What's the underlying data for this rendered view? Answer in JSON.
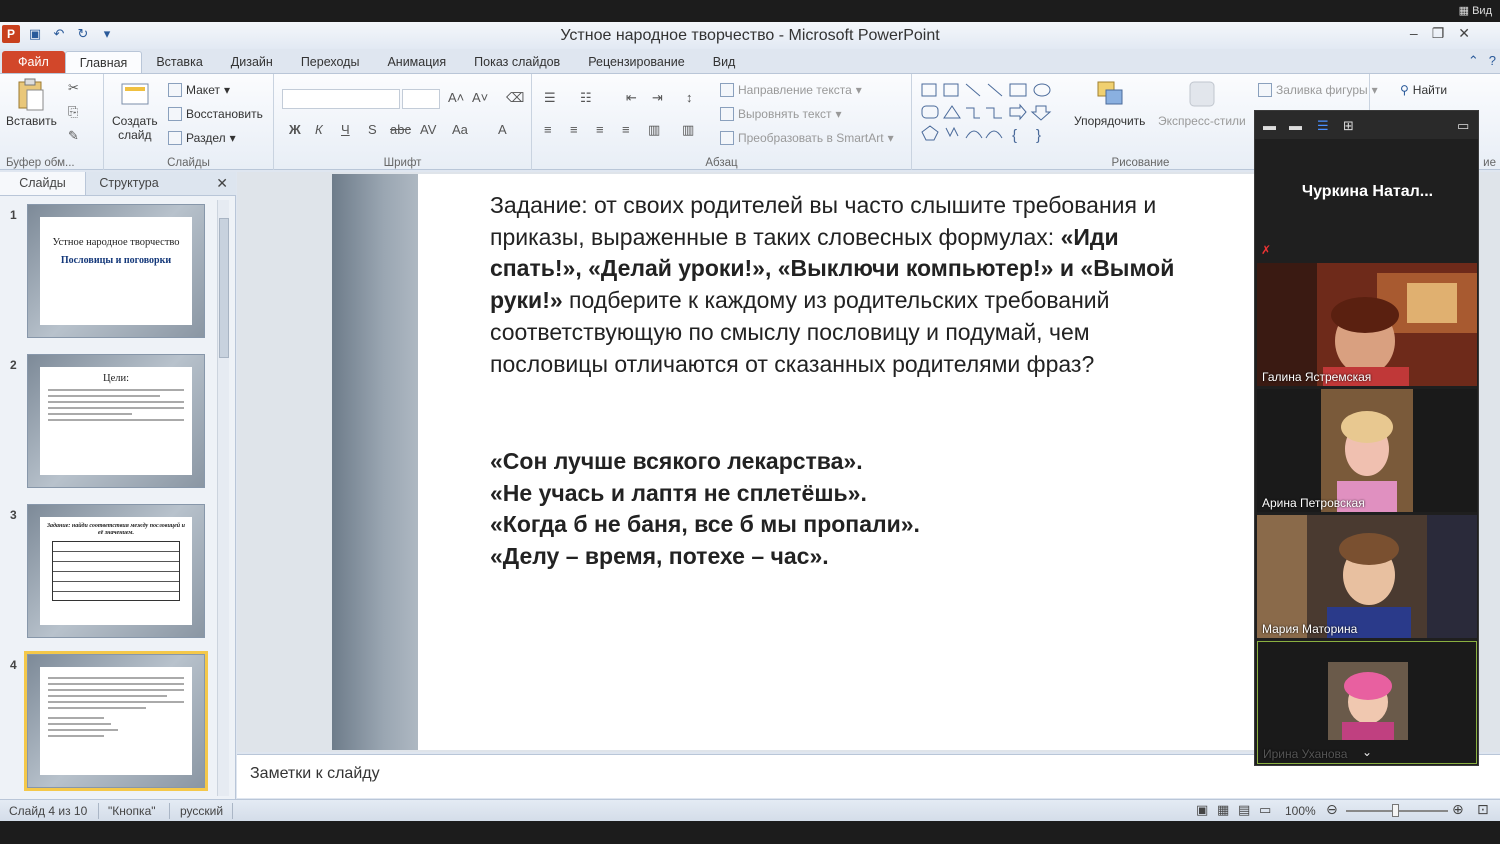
{
  "window": {
    "title": "Устное народное творчество  -  Microsoft PowerPoint"
  },
  "overlay": {
    "zoom_view_label": "Вид"
  },
  "ribbon": {
    "tabs": [
      "Файл",
      "Главная",
      "Вставка",
      "Дизайн",
      "Переходы",
      "Анимация",
      "Показ слайдов",
      "Рецензирование",
      "Вид"
    ],
    "active_tab": "Главная",
    "clipboard": {
      "paste": "Вставить",
      "label": "Буфер обм..."
    },
    "slides": {
      "create": "Создать",
      "create2": "слайд",
      "layout": "Макет",
      "reset": "Восстановить",
      "section": "Раздел",
      "label": "Слайды"
    },
    "font": {
      "label": "Шрифт",
      "bold": "Ж",
      "italic": "К",
      "underline": "Ч",
      "shadow": "S",
      "strike": "abc",
      "case": "Aa",
      "color": "A"
    },
    "paragraph": {
      "text_direction": "Направление текста",
      "align_text": "Выровнять текст",
      "smartart": "Преобразовать в SmartArt",
      "label": "Абзац"
    },
    "drawing": {
      "arrange": "Упорядочить",
      "quick_styles": "Экспресс-стили",
      "fill": "Заливка фигуры",
      "label": "Рисование"
    },
    "editing": {
      "find": "Найти",
      "cut_label": "ие"
    }
  },
  "left_pane": {
    "tabs": [
      "Слайды",
      "Структура"
    ],
    "thumbs": [
      {
        "num": "1",
        "title": "Устное народное творчество",
        "subtitle": "Пословицы и поговорки"
      },
      {
        "num": "2",
        "title": "Цели:"
      },
      {
        "num": "3",
        "title": "Задание: найди соответствия между пословицей и её значением."
      },
      {
        "num": "4",
        "title": ""
      }
    ]
  },
  "slide": {
    "task_intro": "Задание: от своих родителей вы часто слышите требования и приказы, выраженные в таких словесных формулах: ",
    "task_bold": "«Иди спать!», «Делай уроки!», «Выключи компьютер!» и «Вымой руки!»",
    "task_rest": " подберите к каждому из родительских требований соответствующую по смыслу пословицу и подумай, чем пословицы отличаются от сказанных родителями фраз?",
    "proverbs": [
      "«Сон лучше всякого лекарства».",
      "«Не учась и лаптя не сплетёшь».",
      "«Когда б не баня, все б мы пропали».",
      "«Делу – время, потехе – час»."
    ]
  },
  "notes": {
    "placeholder": "Заметки к слайду"
  },
  "status": {
    "slide": "Слайд 4 из 10",
    "theme": "\"Кнопка\"",
    "language": "русский",
    "zoom": "100%"
  },
  "zoom_panel": {
    "host": "Чуркина  Натал...",
    "participants": [
      "Галина Ястремская",
      "Арина Петровская",
      "Мария Маторина",
      "Ирина Уханова"
    ]
  },
  "colors": {
    "file_tab": "#d2472a",
    "selected_thumb": "#f4c84a",
    "zoom_bg": "#1f1f1f"
  }
}
